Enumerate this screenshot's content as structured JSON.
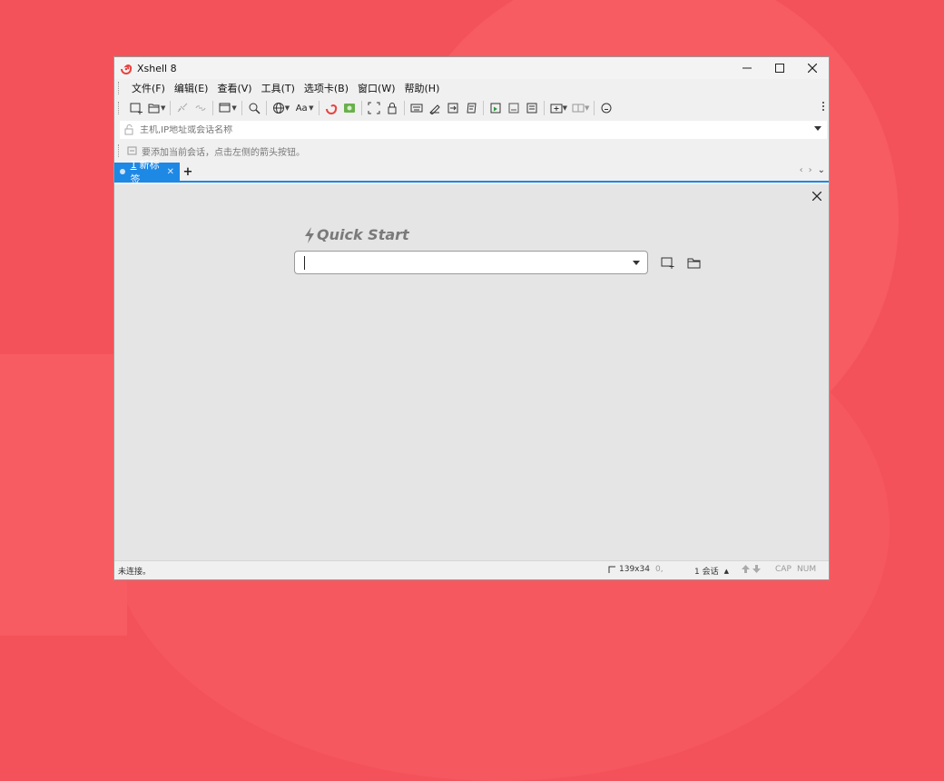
{
  "window": {
    "title": "Xshell 8"
  },
  "menu": [
    "文件(F)",
    "编辑(E)",
    "查看(V)",
    "工具(T)",
    "选项卡(B)",
    "窗口(W)",
    "帮助(H)"
  ],
  "toolbar": {
    "icons": [
      "new-session-icon",
      "open-folder-icon",
      "disconnect-icon",
      "reconnect-icon",
      "new-window-icon",
      "find-icon",
      "globe-icon",
      "font-icon",
      "xshell-icon",
      "xftp-icon",
      "fullscreen-icon",
      "lock-icon",
      "keyboard-icon",
      "script-icon",
      "transfer-icon",
      "log-icon",
      "compose-icon",
      "compose-bar-icon",
      "notes-icon",
      "add-tab-icon",
      "layout-icon",
      "chat-icon"
    ],
    "font_label": "Aa"
  },
  "address_bar": {
    "placeholder": "主机,IP地址或会话名称"
  },
  "hint": {
    "text": "要添加当前会话，点击左侧的箭头按钮。"
  },
  "tabs": [
    {
      "number": "1",
      "label": "新标签",
      "active": true
    }
  ],
  "quick_start": {
    "title": "Quick Start",
    "value": ""
  },
  "status": {
    "left": "未连接。",
    "size": "139x34",
    "cursor": "0,",
    "sessions": "1 会话",
    "cap": "CAP",
    "num": "NUM"
  },
  "colors": {
    "accent": "#1e88e5",
    "background": "#f4525a"
  }
}
